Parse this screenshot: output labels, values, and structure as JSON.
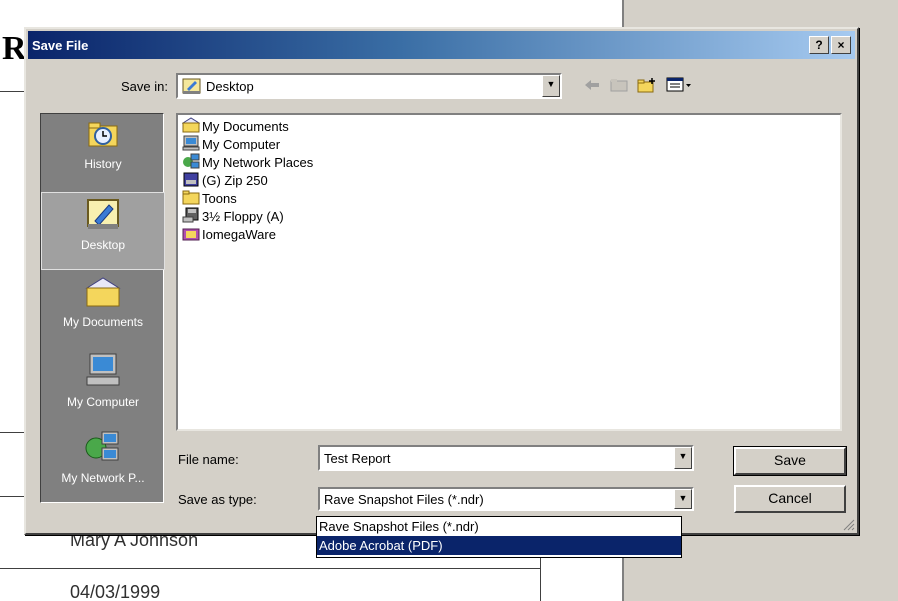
{
  "background": {
    "doc_title_fragment": "Re",
    "author_fragment": "Mary A Johnson",
    "date_fragment": "04/03/1999"
  },
  "dialog": {
    "title": "Save File",
    "help_btn": "?",
    "close_btn": "×"
  },
  "save_in": {
    "label": "Save in:",
    "value": "Desktop"
  },
  "places": [
    {
      "label": "History",
      "icon": "history-icon",
      "selected": false
    },
    {
      "label": "Desktop",
      "icon": "desktop-icon",
      "selected": true
    },
    {
      "label": "My Documents",
      "icon": "my-documents-icon",
      "selected": false
    },
    {
      "label": "My Computer",
      "icon": "my-computer-icon",
      "selected": false
    },
    {
      "label": "My Network P...",
      "icon": "network-places-icon",
      "selected": false
    }
  ],
  "files": [
    {
      "label": "My Documents",
      "icon": "folder-documents-icon"
    },
    {
      "label": "My Computer",
      "icon": "computer-icon"
    },
    {
      "label": "My Network Places",
      "icon": "network-icon"
    },
    {
      "label": "(G) Zip 250",
      "icon": "zip-drive-icon"
    },
    {
      "label": "Toons",
      "icon": "folder-icon"
    },
    {
      "label": "3½ Floppy (A)",
      "icon": "floppy-icon"
    },
    {
      "label": "IomegaWare",
      "icon": "app-folder-icon"
    }
  ],
  "file_name": {
    "label": "File name:",
    "value": "Test Report"
  },
  "save_as_type": {
    "label": "Save as type:",
    "value": "Rave Snapshot Files (*.ndr)",
    "options": [
      "Rave Snapshot Files (*.ndr)",
      "Adobe Acrobat (PDF)"
    ],
    "highlighted": "Adobe Acrobat (PDF)"
  },
  "buttons": {
    "save": "Save",
    "cancel": "Cancel"
  },
  "colors": {
    "title_start": "#0a246a",
    "title_end": "#a6caf0",
    "face": "#d4d0c8",
    "highlight": "#0a246a"
  }
}
